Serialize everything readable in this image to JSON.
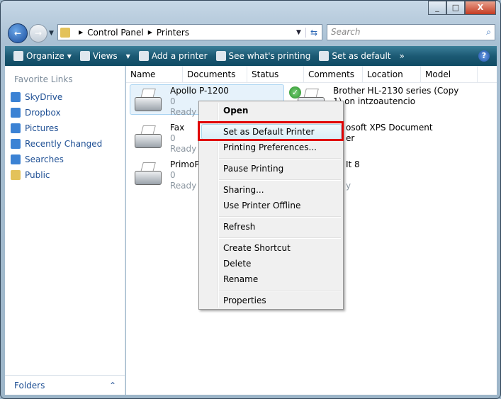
{
  "window": {
    "minimize": "_",
    "maximize": "□",
    "close": "X"
  },
  "address": {
    "crumbs": [
      "Control Panel",
      "Printers"
    ]
  },
  "search": {
    "placeholder": "Search"
  },
  "toolbar": {
    "organize": "Organize",
    "views": "Views",
    "add_printer": "Add a printer",
    "see_printing": "See what's printing",
    "set_default": "Set as default",
    "more": "»",
    "help": "?"
  },
  "sidebar": {
    "title": "Favorite Links",
    "items": [
      {
        "label": "SkyDrive"
      },
      {
        "label": "Dropbox"
      },
      {
        "label": "Pictures"
      },
      {
        "label": "Recently Changed"
      },
      {
        "label": "Searches"
      },
      {
        "label": "Public"
      }
    ],
    "folders": "Folders"
  },
  "columns": [
    "Name",
    "Documents",
    "Status",
    "Comments",
    "Location",
    "Model"
  ],
  "printers": [
    {
      "name": "Apollo P-1200",
      "docs": "0",
      "status": "Ready"
    },
    {
      "name": "Fax",
      "docs": "0",
      "status": "Ready"
    },
    {
      "name": "PrimoPD",
      "docs": "0",
      "status": "Ready"
    },
    {
      "name": "Brother HL-2130 series (Copy",
      "name2": "1) on intzoautencio"
    },
    {
      "name": "osoft XPS Document",
      "name2": "er"
    },
    {
      "name": "It 8",
      "name2": "y"
    }
  ],
  "context_menu": [
    "Open",
    "Set as Default Printer",
    "Printing Preferences...",
    "Pause Printing",
    "Sharing...",
    "Use Printer Offline",
    "Refresh",
    "Create Shortcut",
    "Delete",
    "Rename",
    "Properties"
  ]
}
